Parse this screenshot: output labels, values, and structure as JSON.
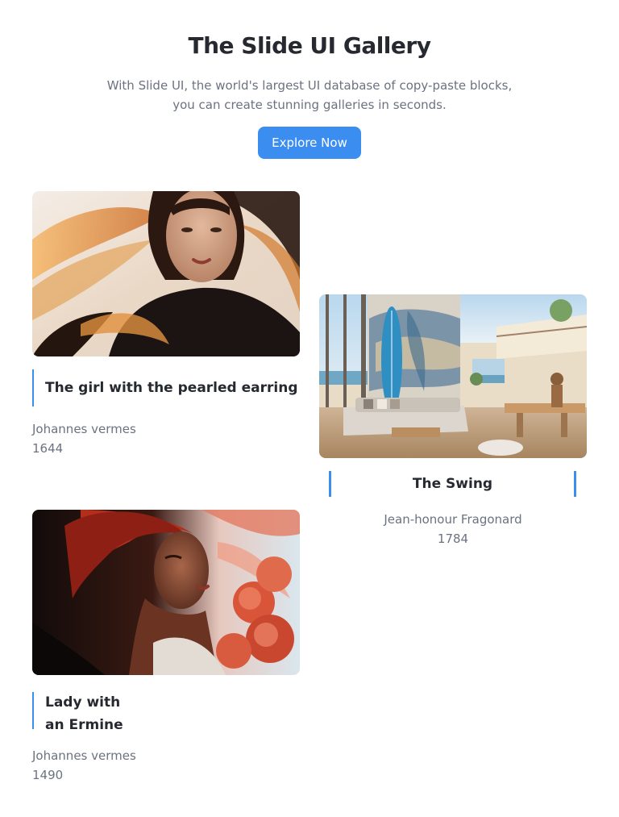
{
  "header": {
    "title": "The Slide UI Gallery",
    "subtitle_line1": "With Slide UI, the world's largest UI database of copy-paste blocks,",
    "subtitle_line2": "you can create stunning galleries in seconds.",
    "cta_label": "Explore Now"
  },
  "artworks": [
    {
      "title": "The girl with the pearled earring",
      "artist": "Johannes vermes",
      "year": "1644"
    },
    {
      "title": "The Swing",
      "artist": "Jean-honour Fragonard",
      "year": "1784"
    },
    {
      "title_line1": "Lady with",
      "title_line2": "an Ermine",
      "artist": "Johannes vermes",
      "year": "1490"
    }
  ],
  "colors": {
    "accent": "#3b8ef0",
    "heading": "#262a30",
    "muted": "#6b7280"
  }
}
